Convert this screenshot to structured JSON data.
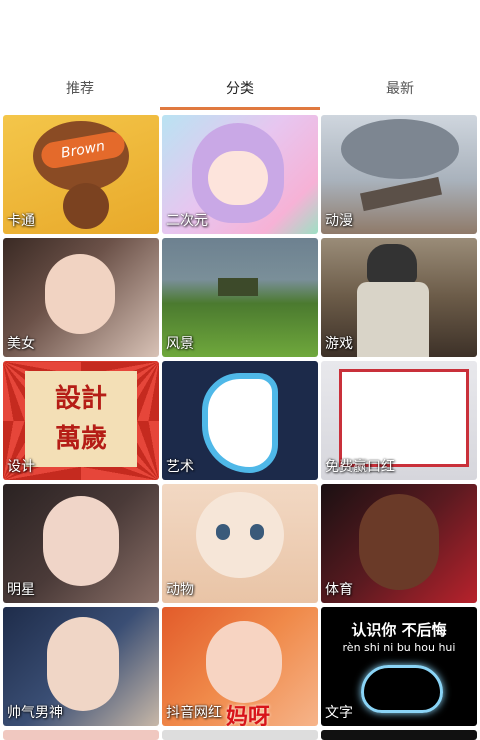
{
  "tabs": [
    {
      "label": "推荐"
    },
    {
      "label": "分类"
    },
    {
      "label": "最新"
    }
  ],
  "active_tab": "分类",
  "categories": [
    {
      "label": "卡通",
      "overlay": "Brown"
    },
    {
      "label": "二次元"
    },
    {
      "label": "动漫"
    },
    {
      "label": "美女"
    },
    {
      "label": "风景"
    },
    {
      "label": "游戏"
    },
    {
      "label": "设计",
      "overlay_lines": [
        "設計",
        "萬歲"
      ]
    },
    {
      "label": "艺术"
    },
    {
      "label": "免费赢口红"
    },
    {
      "label": "明星"
    },
    {
      "label": "动物"
    },
    {
      "label": "体育"
    },
    {
      "label": "帅气男神"
    },
    {
      "label": "抖音网红",
      "overlay": "妈呀"
    },
    {
      "label": "文字",
      "overlay_lines": [
        "认识你  不后悔",
        "rèn shi ni    bu hou hui"
      ]
    }
  ]
}
